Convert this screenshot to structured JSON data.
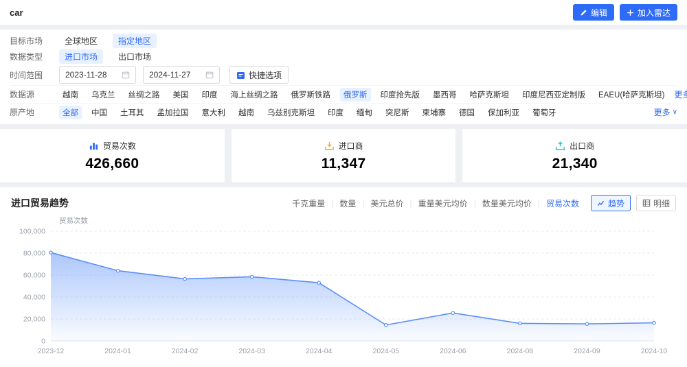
{
  "header": {
    "title": "car",
    "buttons": [
      {
        "id": "edit-button",
        "label": "编辑",
        "icon": "edit"
      },
      {
        "id": "add-radar-button",
        "label": "加入雷达",
        "icon": "plus"
      }
    ]
  },
  "filters": [
    {
      "id": "target-market",
      "label": "目标市场",
      "type": "options",
      "options": [
        "全球地区",
        "指定地区"
      ],
      "selected": "指定地区"
    },
    {
      "id": "data-type",
      "label": "数据类型",
      "type": "options",
      "options": [
        "进口市场",
        "出口市场"
      ],
      "selected": "进口市场"
    },
    {
      "id": "time-range",
      "label": "时间范围",
      "type": "daterange",
      "start": "2023-11-28",
      "end": "2024-11-27",
      "quick_label": "快捷选项"
    },
    {
      "id": "data-source",
      "label": "数据源",
      "type": "options",
      "wide": true,
      "options": [
        "越南",
        "乌克兰",
        "丝绸之路",
        "美国",
        "印度",
        "海上丝绸之路",
        "俄罗斯铁路",
        "俄罗斯",
        "印度抢先版",
        "墨西哥",
        "哈萨克斯坦",
        "印度尼西亚定制版",
        "EAEU(哈萨克斯坦)"
      ],
      "selected": "俄罗斯",
      "more_label": "更多"
    },
    {
      "id": "origin",
      "label": "原产地",
      "type": "options",
      "wide": true,
      "options": [
        "全部",
        "中国",
        "土耳其",
        "孟加拉国",
        "意大利",
        "越南",
        "乌兹别克斯坦",
        "印度",
        "缅甸",
        "突尼斯",
        "柬埔寨",
        "德国",
        "保加利亚",
        "葡萄牙"
      ],
      "selected": "全部",
      "more_label": "更多"
    }
  ],
  "stats": [
    {
      "id": "trade-count",
      "label": "贸易次数",
      "value": "426,660",
      "icon": "bar-chart"
    },
    {
      "id": "importers",
      "label": "进口商",
      "value": "11,347",
      "icon": "importer"
    },
    {
      "id": "exporters",
      "label": "出口商",
      "value": "21,340",
      "icon": "exporter"
    }
  ],
  "trend": {
    "title": "进口贸易趋势",
    "metrics": [
      "千克重量",
      "数量",
      "美元总价",
      "重量美元均价",
      "数量美元均价",
      "贸易次数"
    ],
    "selected_metric": "贸易次数",
    "views": [
      {
        "id": "trend",
        "label": "趋势",
        "icon": "trend",
        "selected": true
      },
      {
        "id": "detail",
        "label": "明细",
        "icon": "detail",
        "selected": false
      }
    ]
  },
  "chart_data": {
    "type": "area",
    "title": "进口贸易趋势",
    "ylabel": "贸易次数",
    "x": [
      "2023-12",
      "2024-01",
      "2024-02",
      "2024-03",
      "2024-04",
      "2024-05",
      "2024-06",
      "2024-08",
      "2024-09",
      "2024-10"
    ],
    "values": [
      80500,
      64000,
      56500,
      58500,
      53000,
      14500,
      25500,
      16000,
      15500,
      16500
    ],
    "ylim": [
      0,
      100000
    ],
    "yticks": [
      0,
      20000,
      40000,
      60000,
      80000,
      100000
    ],
    "grid": "dashed",
    "legend": false,
    "line_color": "#5b8ff9",
    "accent_color": "#2e6bf6"
  },
  "colors": {
    "accent": "#2e6bf6",
    "selected_bg": "#e8f1ff",
    "importer_icon": "#f7a825",
    "exporter_icon": "#22c3c6",
    "page_bg": "#eef0f4"
  }
}
